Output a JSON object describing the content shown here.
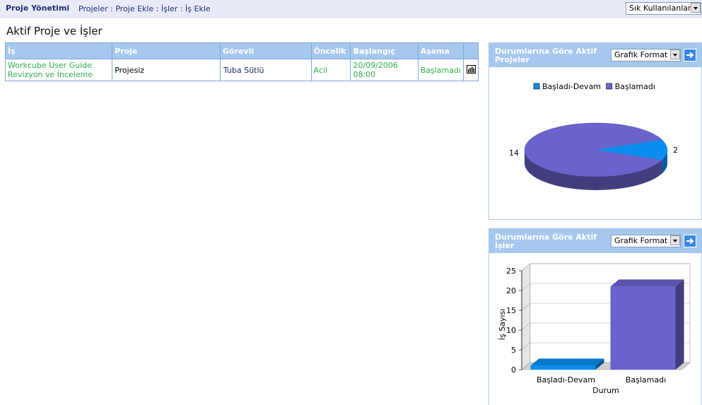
{
  "topbar": {
    "title": "Proje Yönetimi",
    "crumbs": [
      "Projeler",
      ":",
      "Proje Ekle",
      ":",
      "İşler",
      ":",
      "İş Ekle"
    ],
    "quick_select_value": "Sık Kullanılanlar"
  },
  "page_title": "Aktif Proje ve İşler",
  "table": {
    "headers": [
      "İş",
      "Proje",
      "Görevli",
      "Öncelik",
      "Başlangıç",
      "Aşama",
      ""
    ],
    "rows": [
      {
        "is_line1": "Workcube User Guide",
        "is_line2": "Revizyon ve İnceleme",
        "proje": "Projesiz",
        "gorevli": "Tuba Sütlü",
        "oncelik": "Acil",
        "baslangic": "20/09/2006 08:00",
        "asama": "Başlamadı",
        "icon": "bar-chart-icon"
      }
    ]
  },
  "panel_projects": {
    "title": "Durumlarına Göre Aktif Projeler",
    "format_value": "Grafik Format"
  },
  "panel_tasks": {
    "title": "Durumlarına Göre Aktif İşler",
    "format_value": "Grafik Format"
  },
  "colors": {
    "header_blue": "#a6c8ee",
    "series_blue": "#0a8ef0",
    "series_purple": "#6a63cc",
    "green_text": "#2db14b"
  },
  "chart_data": [
    {
      "type": "pie",
      "legend": [
        "Başladı-Devam",
        "Başlamadı"
      ],
      "values": [
        2,
        14
      ],
      "labels": [
        "2",
        "14"
      ],
      "colors": [
        "#0a8ef0",
        "#6a63cc"
      ],
      "legend_position": "top"
    },
    {
      "type": "bar",
      "categories": [
        "Başladı-Devam",
        "Başlamadı"
      ],
      "values": [
        1,
        21
      ],
      "colors": [
        "#0a8ef0",
        "#6a63cc"
      ],
      "xlabel": "Durum",
      "ylabel": "İş Sayısı",
      "ylim": [
        0,
        25
      ],
      "yticks": [
        "0",
        "5",
        "10",
        "15",
        "20",
        "25"
      ],
      "grid": true
    }
  ]
}
